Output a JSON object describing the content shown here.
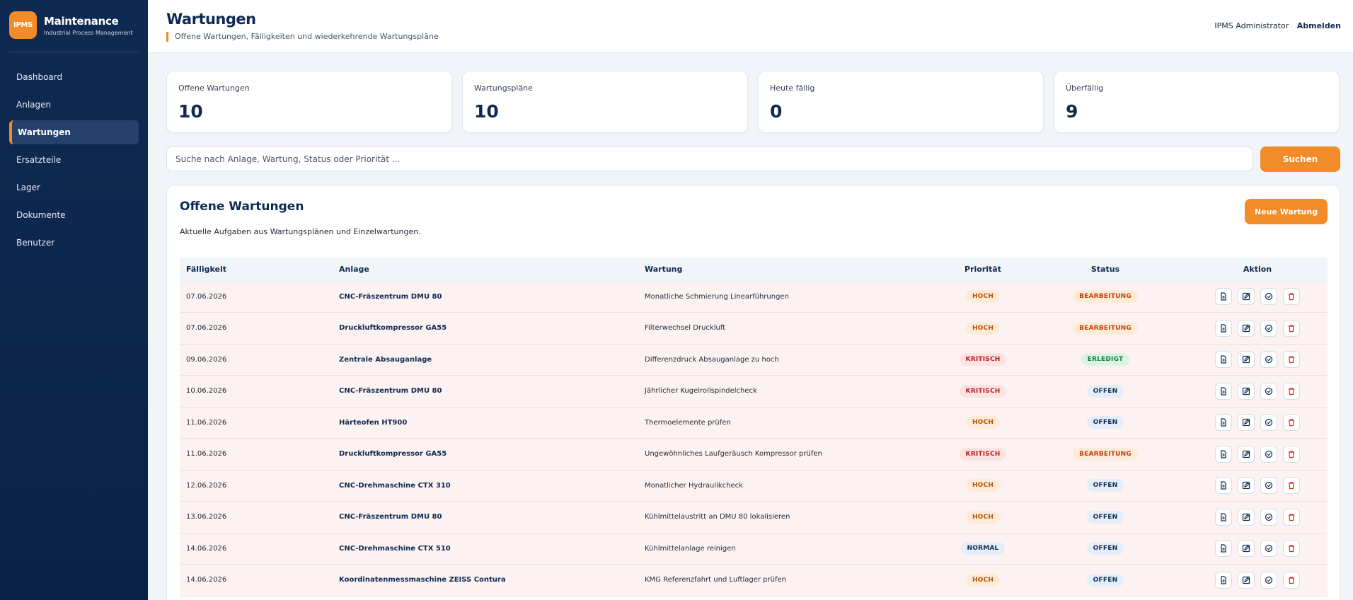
{
  "brand": {
    "logo": "IPMS",
    "title": "Maintenance",
    "subtitle": "Industrial Process Management"
  },
  "nav": [
    {
      "label": "Dashboard",
      "active": false
    },
    {
      "label": "Anlagen",
      "active": false
    },
    {
      "label": "Wartungen",
      "active": true
    },
    {
      "label": "Ersatzteile",
      "active": false
    },
    {
      "label": "Lager",
      "active": false
    },
    {
      "label": "Dokumente",
      "active": false
    },
    {
      "label": "Benutzer",
      "active": false
    }
  ],
  "header": {
    "title": "Wartungen",
    "subtitle": "Offene Wartungen, Fälligkeiten und wiederkehrende Wartungspläne",
    "user": "IPMS Administrator",
    "logout": "Abmelden"
  },
  "stats": [
    {
      "label": "Offene Wartungen",
      "value": "10"
    },
    {
      "label": "Wartungspläne",
      "value": "10"
    },
    {
      "label": "Heute fällig",
      "value": "0"
    },
    {
      "label": "Überfällig",
      "value": "9"
    }
  ],
  "search": {
    "placeholder": "Suche nach Anlage, Wartung, Status oder Priorität ...",
    "button": "Suchen"
  },
  "panel": {
    "title": "Offene Wartungen",
    "description": "Aktuelle Aufgaben aus Wartungsplänen und Einzelwartungen.",
    "new_button": "Neue Wartung"
  },
  "table": {
    "headers": {
      "due": "Fälligkeit",
      "asset": "Anlage",
      "task": "Wartung",
      "priority": "Priorität",
      "status": "Status",
      "action": "Aktion"
    },
    "rows": [
      {
        "due": "07.06.2026",
        "asset": "CNC-Fräszentrum DMU 80",
        "task": "Monatliche Schmierung Linearführungen",
        "priority": "HOCH",
        "status": "BEARBEITUNG"
      },
      {
        "due": "07.06.2026",
        "asset": "Druckluftkompressor GA55",
        "task": "Filterwechsel Druckluft",
        "priority": "HOCH",
        "status": "BEARBEITUNG"
      },
      {
        "due": "09.06.2026",
        "asset": "Zentrale Absauganlage",
        "task": "Differenzdruck Absauganlage zu hoch",
        "priority": "KRITISCH",
        "status": "ERLEDIGT"
      },
      {
        "due": "10.06.2026",
        "asset": "CNC-Fräszentrum DMU 80",
        "task": "Jährlicher Kugelrollspindelcheck",
        "priority": "KRITISCH",
        "status": "OFFEN"
      },
      {
        "due": "11.06.2026",
        "asset": "Härteofen HT900",
        "task": "Thermoelemente prüfen",
        "priority": "HOCH",
        "status": "OFFEN"
      },
      {
        "due": "11.06.2026",
        "asset": "Druckluftkompressor GA55",
        "task": "Ungewöhnliches Laufgeräusch Kompressor prüfen",
        "priority": "KRITISCH",
        "status": "BEARBEITUNG"
      },
      {
        "due": "12.06.2026",
        "asset": "CNC-Drehmaschine CTX 310",
        "task": "Monatlicher Hydraulikcheck",
        "priority": "HOCH",
        "status": "OFFEN"
      },
      {
        "due": "13.06.2026",
        "asset": "CNC-Fräszentrum DMU 80",
        "task": "Kühlmittelaustritt an DMU 80 lokalisieren",
        "priority": "HOCH",
        "status": "OFFEN"
      },
      {
        "due": "14.06.2026",
        "asset": "CNC-Drehmaschine CTX 510",
        "task": "Kühlmittelanlage reinigen",
        "priority": "NORMAL",
        "status": "OFFEN"
      },
      {
        "due": "14.06.2026",
        "asset": "Koordinatenmessmaschine ZEISS Contura",
        "task": "KMG Referenzfahrt und Luftlager prüfen",
        "priority": "HOCH",
        "status": "OFFEN"
      }
    ],
    "actions": [
      "document-icon",
      "edit-icon",
      "check-icon",
      "trash-icon"
    ]
  },
  "colors": {
    "accent": "#f28c28",
    "navy": "#0f2a52",
    "row_bg": "#fdf2f2"
  }
}
